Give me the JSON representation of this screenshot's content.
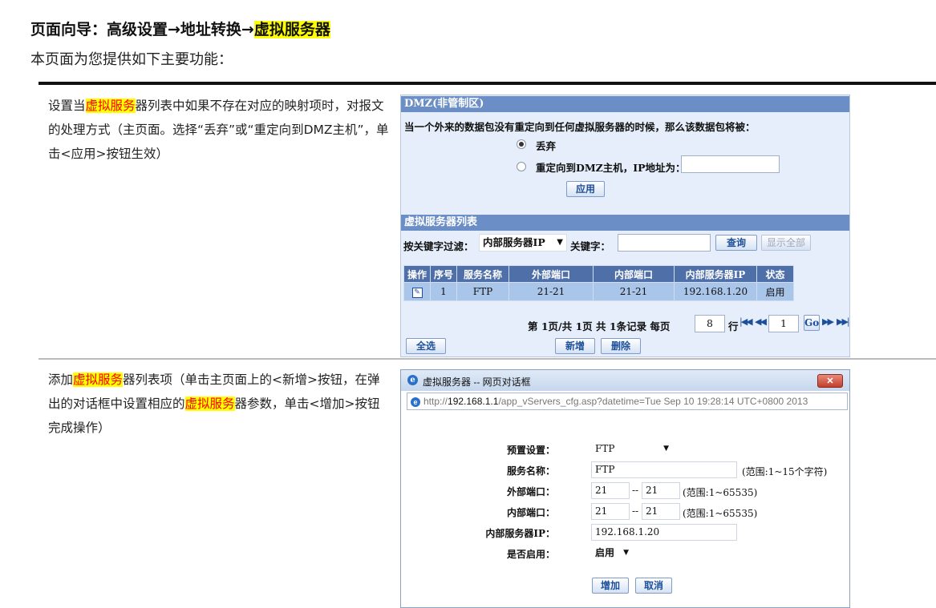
{
  "header": {
    "title_prefix": "页面向导：高级设置→地址转换→",
    "title_highlight": "虚拟服务器",
    "subtitle": "本页面为您提供如下主要功能："
  },
  "row1": {
    "desc_a": "设置当",
    "desc_hl": "虚拟服务",
    "desc_b": "器列表中如果不存在对应的映射项时，对报文的处理方式（主页面。选择“丢弃”或“重定向到DMZ主机”，单击<应用>按钮生效）",
    "dmz_header": "DMZ(非管制区)",
    "dmz_desc": "当一个外来的数据包没有重定向到任何虚拟服务器的时候，那么该数据包将被：",
    "option_drop": "丢弃",
    "option_redirect": "重定向到DMZ主机，IP地址为：",
    "ip_value": "",
    "apply_label": "应用",
    "list_header": "虚拟服务器列表",
    "filter_label": "按关键字过滤：",
    "filter_select": "内部服务器IP",
    "keyword_label": "关键字：",
    "keyword_value": "",
    "search_label": "查询",
    "showall_label": "显示全部",
    "columns": [
      "操作",
      "序号",
      "服务名称",
      "外部端口",
      "内部端口",
      "内部服务器IP",
      "状态"
    ],
    "rows": [
      {
        "no": "1",
        "name": "FTP",
        "ext": "21-21",
        "int": "21-21",
        "ip": "192.168.1.20",
        "status": "启用"
      }
    ],
    "pager_text": "第 1页/共 1页 共 1条记录 每页",
    "per_page": "8",
    "rows_unit": "行",
    "page_value": "1",
    "go_label": "Go",
    "selectall_label": "全选",
    "add_label": "新增",
    "delete_label": "删除"
  },
  "row2": {
    "desc_a": "添加",
    "desc_hl1": "虚拟服务",
    "desc_b": "器列表项（单击主页面上的<新增>按钮，在弹出的对话框中设置相应的",
    "desc_hl2": "虚拟服务",
    "desc_c": "器参数，单击<增加>按钮完成操作）",
    "dialog_title": "虚拟服务器 -- 网页对话框",
    "url_prefix": "http://",
    "url_host": "192.168.1.1",
    "url_path": "/app_vServers_cfg.asp?datetime=Tue Sep 10 19:28:14 UTC+0800 2013",
    "preset_label": "预置设置：",
    "preset_value": "FTP",
    "name_label": "服务名称：",
    "name_value": "FTP",
    "name_note": "(范围:1~15个字符)",
    "ext_label": "外部端口：",
    "ext_from": "21",
    "ext_to": "21",
    "ext_note": "(范围:1~65535)",
    "int_label": "内部端口：",
    "int_from": "21",
    "int_to": "21",
    "int_note": "(范围:1~65535)",
    "ip_label": "内部服务器IP：",
    "ip_value": "192.168.1.20",
    "enable_label": "是否启用：",
    "enable_value": "启用",
    "range_sep": "--",
    "add_label": "增加",
    "cancel_label": "取消"
  }
}
